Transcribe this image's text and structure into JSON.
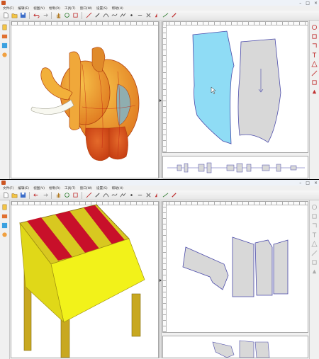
{
  "top_window": {
    "title": "",
    "menu": [
      "文件(F)",
      "编辑(E)",
      "视图(V)",
      "绘制(R)",
      "工具(T)",
      "窗口(W)",
      "设置(S)",
      "帮助(H)"
    ]
  },
  "bottom_window": {
    "title": "",
    "menu": [
      "文件(F)",
      "编辑(E)",
      "视图(V)",
      "绘制(R)",
      "工具(T)",
      "窗口(W)",
      "设置(S)",
      "帮助(H)"
    ]
  },
  "toolbar_icons": [
    "new-icon",
    "open-icon",
    "save-icon",
    "undo-icon",
    "redo-icon",
    "hand-icon",
    "rotate-icon",
    "select-icon",
    "line-icon",
    "pen-icon",
    "curve-icon",
    "spline-icon",
    "polyline-icon",
    "point-icon",
    "dot-icon",
    "cut-icon",
    "mirror-icon",
    "measure-icon",
    "erase-icon"
  ],
  "right_tools_top": [
    "circle-icon",
    "rectangle-icon",
    "notch-icon",
    "text-icon",
    "grading-icon",
    "dart-icon",
    "square-icon",
    "print-icon"
  ],
  "colors": {
    "pattern_selected": "#8fdcf5",
    "pattern_grey": "#d8d8d8",
    "pattern_stroke": "#4a4aaa",
    "elephant_orange": "#e8882a",
    "elephant_yellow": "#f2b23a",
    "chair_yellow": "#f2f21a",
    "chair_red": "#c8102a"
  }
}
